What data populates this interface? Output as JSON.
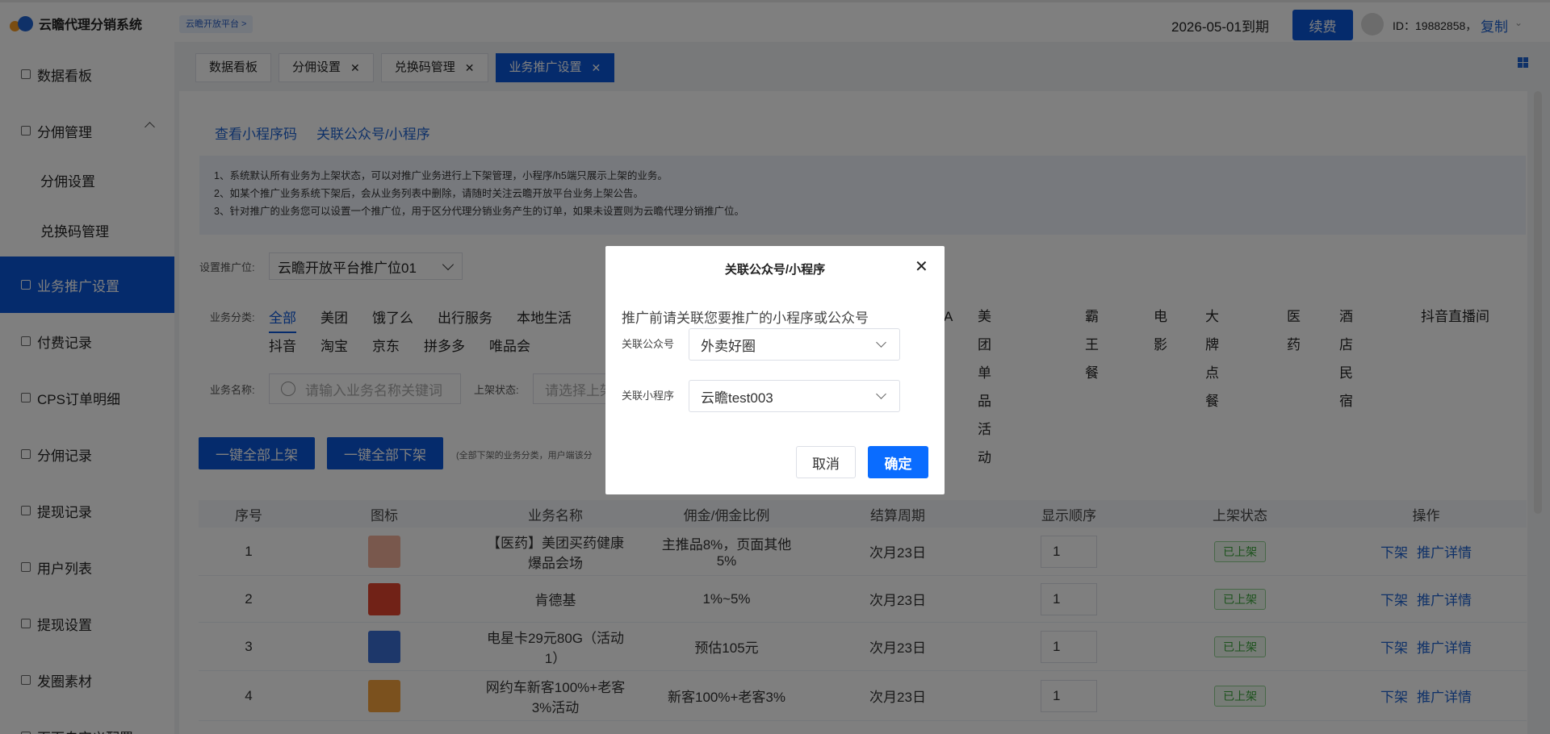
{
  "header": {
    "app_name": "云瞻代理分销系统",
    "platform_badge": "云瞻开放平台 >",
    "expire_text": "2026-05-01到期",
    "renew_label": "续费",
    "user_id": "ID：19882858，",
    "copy_label": "复制",
    "chevron": "⌄"
  },
  "sidebar": {
    "items": [
      {
        "label": "数据看板",
        "icon": "dashboard-icon"
      },
      {
        "label": "分佣管理",
        "icon": "user-icon"
      },
      {
        "label": "分佣设置",
        "icon": ""
      },
      {
        "label": "兑换码管理",
        "icon": ""
      },
      {
        "label": "业务推广设置",
        "icon": "settings-icon"
      },
      {
        "label": "付费记录",
        "icon": "pay-icon"
      },
      {
        "label": "CPS订单明细",
        "icon": "order-icon"
      },
      {
        "label": "分佣记录",
        "icon": "record-icon"
      },
      {
        "label": "提现记录",
        "icon": "withdraw-icon"
      },
      {
        "label": "用户列表",
        "icon": "users-icon"
      },
      {
        "label": "提现设置",
        "icon": "withdraw-settings-icon"
      },
      {
        "label": "发圈素材",
        "icon": "material-icon"
      },
      {
        "label": "页面自定义配置",
        "icon": "page-icon"
      }
    ]
  },
  "tabs": [
    {
      "label": "数据看板",
      "closable": false
    },
    {
      "label": "分佣设置",
      "closable": true
    },
    {
      "label": "兑换码管理",
      "closable": true
    },
    {
      "label": "业务推广设置",
      "closable": true
    }
  ],
  "tab_close_glyph": "✕",
  "main": {
    "links": [
      "查看小程序码",
      "关联公众号/小程序"
    ],
    "notice": [
      "1、系统默认所有业务为上架状态，可以对推广业务进行上下架管理，小程序/h5端只展示上架的业务。",
      "2、如某个推广业务系统下架后，会从业务列表中删除，请随时关注云瞻开放平台业务上架公告。",
      "3、针对推广的业务您可以设置一个推广位，用于区分代理分销业务产生的订单，如果未设置则为云瞻代理分销推广位。"
    ],
    "promo_label": "设置推广位:",
    "promo_value": "云瞻开放平台推广位01",
    "category_label": "业务分类:",
    "categories_row1": [
      "全部",
      "美团",
      "饿了么",
      "出行服务",
      "本地生活",
      "美团单品活动",
      "霸王餐",
      "电影",
      "大牌点餐",
      "医药",
      "酒店民宿",
      "抖音直播间"
    ],
    "category_partial": "A",
    "categories_row2": [
      "抖音",
      "淘宝",
      "京东",
      "拼多多",
      "唯品会"
    ],
    "name_label": "业务名称:",
    "name_placeholder": "请输入业务名称关键词",
    "status_label": "上架状态:",
    "status_placeholder": "请选择上架",
    "btn_all_on": "一键全部上架",
    "btn_all_off": "一键全部下架",
    "btn_hint": "(全部下架的业务分类，用户端该分"
  },
  "table": {
    "headers": [
      "序号",
      "图标",
      "业务名称",
      "佣金/佣金比例",
      "结算周期",
      "显示顺序",
      "上架状态",
      "操作"
    ],
    "rows": [
      {
        "no": "1",
        "name": "【医药】美团买药健康爆品会场",
        "commission": "主推品8%，页面其他5%",
        "cycle": "次月23日",
        "order": "1",
        "status": "已上架",
        "thumb_color": "#f3b09a"
      },
      {
        "no": "2",
        "name": "肯德基",
        "commission": "1%~5%",
        "cycle": "次月23日",
        "order": "1",
        "status": "已上架",
        "thumb_color": "#e2442f"
      },
      {
        "no": "3",
        "name": "电星卡29元80G（活动1）",
        "commission": "预估105元",
        "cycle": "次月23日",
        "order": "1",
        "status": "已上架",
        "thumb_color": "#3b6fd4"
      },
      {
        "no": "4",
        "name": "网约车新客100%+老客3%活动",
        "commission": "新客100%+老客3%",
        "cycle": "次月23日",
        "order": "1",
        "status": "已上架",
        "thumb_color": "#f6a23c"
      }
    ],
    "op_off": "下架",
    "op_detail": "推广详情"
  },
  "modal": {
    "title": "关联公众号/小程序",
    "close_glyph": "✕",
    "tip": "推广前请关联您要推广的小程序或公众号",
    "oa_label": "关联公众号",
    "oa_value": "外卖好圈",
    "mp_label": "关联小程序",
    "mp_value": "云瞻test003",
    "cancel_label": "取消",
    "ok_label": "确定"
  },
  "colors": {
    "primary": "#0a56d8",
    "link": "#1e62d0",
    "ok_button": "#0a6cff",
    "status_green": "#3aa53a"
  }
}
